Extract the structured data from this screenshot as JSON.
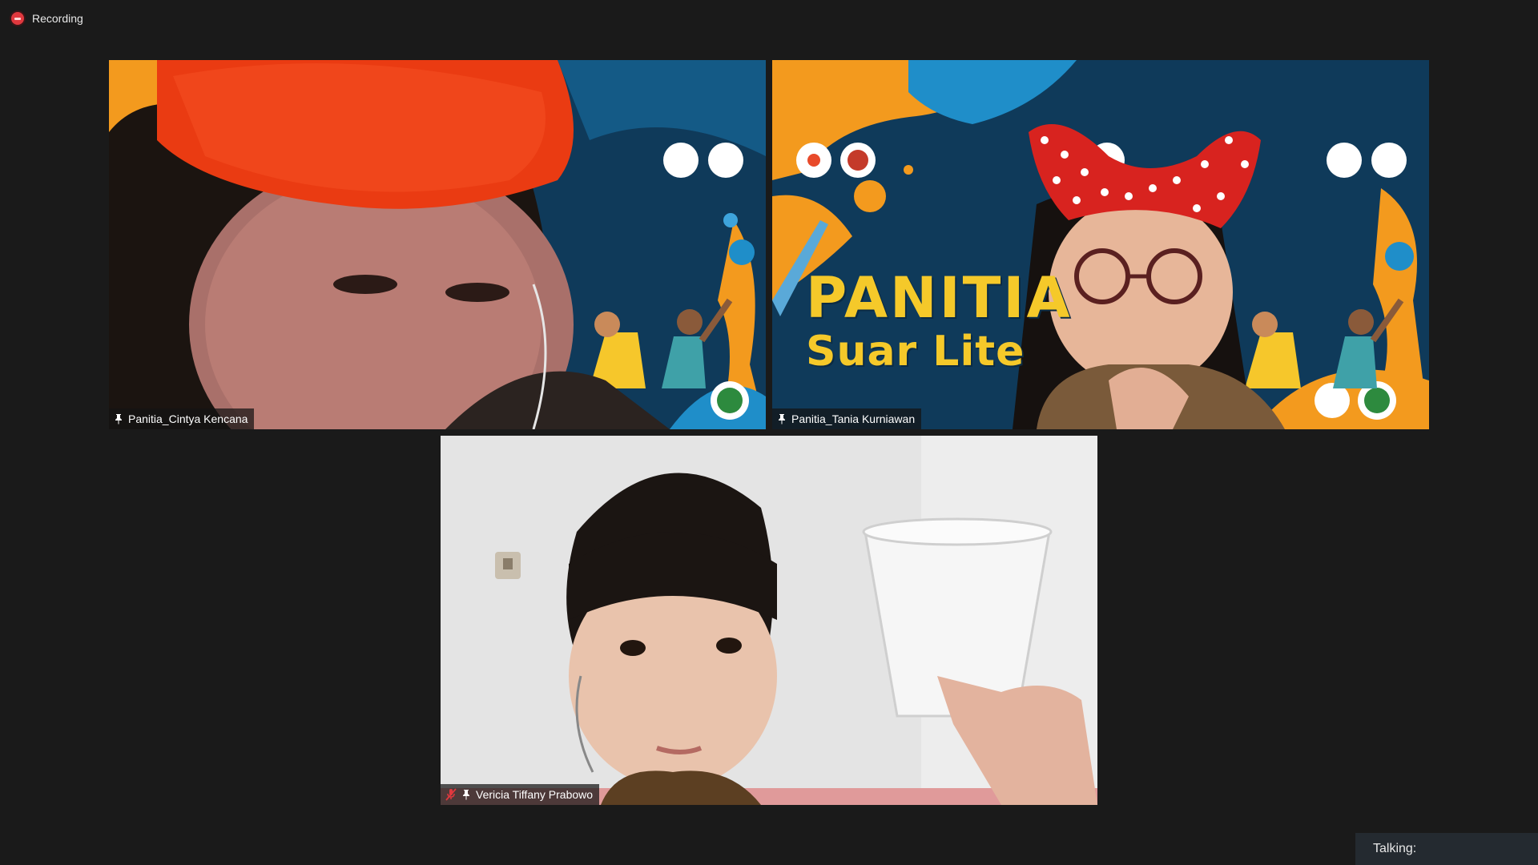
{
  "status": {
    "recording_label": "Recording"
  },
  "participants": [
    {
      "name": "Panitia_Cintya Kencana",
      "pinned": true,
      "muted": false
    },
    {
      "name": "Panitia_Tania Kurniawan",
      "pinned": true,
      "muted": false
    },
    {
      "name": "Vericia Tiffany Prabowo",
      "pinned": true,
      "muted": true
    }
  ],
  "banner": {
    "line1": "PANITIA",
    "line2": "Suar Lite"
  },
  "footer": {
    "talking_label": "Talking:"
  },
  "icons": {
    "recording": "record-icon",
    "pin": "pin-icon",
    "mic_muted": "mic-muted-icon"
  },
  "colors": {
    "background": "#1a1a1a",
    "recording_red": "#e0383e",
    "banner_blue": "#0f3550",
    "banner_orange": "#f39a1e",
    "banner_yellow": "#f5c92a"
  }
}
